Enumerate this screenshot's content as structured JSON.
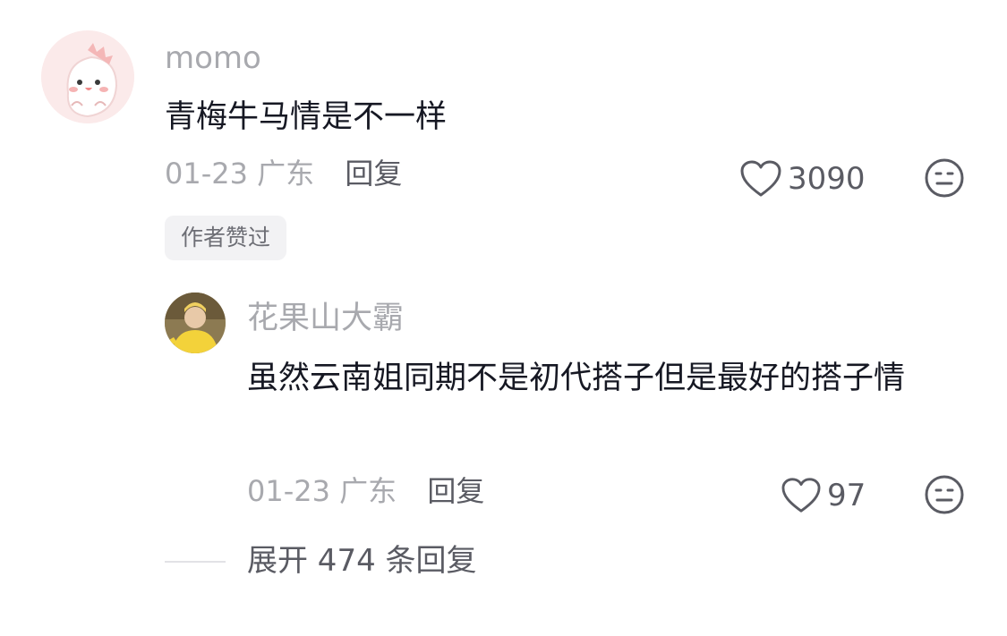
{
  "comment": {
    "username": "momo",
    "text": "青梅牛马情是不一样",
    "date": "01-23",
    "location": "广东",
    "reply_label": "回复",
    "like_count": "3090",
    "badge": "作者赞过",
    "avatar_icon": "cartoon-dinosaur-avatar"
  },
  "reply": {
    "username": "花果山大霸",
    "text": "虽然云南姐同期不是初代搭子但是最好的搭子情",
    "date": "01-23",
    "location": "广东",
    "reply_label": "回复",
    "like_count": "97",
    "avatar_icon": "person-yellow-outfit-avatar"
  },
  "expand": {
    "label": "展开 474 条回复"
  },
  "icons": {
    "like": "heart-outline-icon",
    "dislike": "meh-face-icon"
  },
  "colors": {
    "primary_text": "#161823",
    "secondary_text": "#a8a9ae",
    "action_text": "#5a5b63",
    "badge_bg": "#f2f2f4"
  }
}
